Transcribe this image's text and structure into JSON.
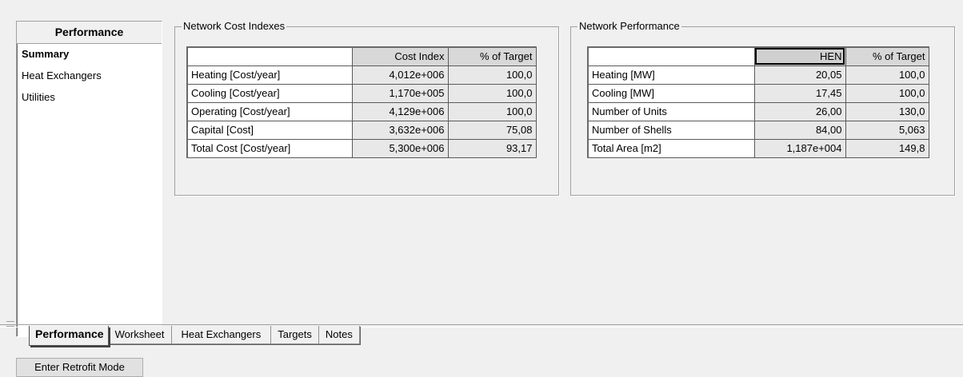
{
  "sidebar": {
    "header": "Performance",
    "items": [
      {
        "label": "Summary"
      },
      {
        "label": "Heat Exchangers"
      },
      {
        "label": "Utilities"
      }
    ]
  },
  "cost_group": {
    "title": "Network Cost Indexes",
    "columns": [
      "",
      "Cost Index",
      "% of Target"
    ],
    "rows": [
      {
        "label": "Heating [Cost/year]",
        "value": "4,012e+006",
        "target": "100,0"
      },
      {
        "label": "Cooling [Cost/year]",
        "value": "1,170e+005",
        "target": "100,0"
      },
      {
        "label": "Operating [Cost/year]",
        "value": "4,129e+006",
        "target": "100,0"
      },
      {
        "label": "Capital [Cost]",
        "value": "3,632e+006",
        "target": "75,08"
      },
      {
        "label": "Total Cost [Cost/year]",
        "value": "5,300e+006",
        "target": "93,17"
      }
    ]
  },
  "perf_group": {
    "title": "Network Performance",
    "columns": [
      "",
      "HEN",
      "% of Target"
    ],
    "rows": [
      {
        "label": "Heating [MW]",
        "value": "20,05",
        "target": "100,0"
      },
      {
        "label": "Cooling [MW]",
        "value": "17,45",
        "target": "100,0"
      },
      {
        "label": "Number of Units",
        "value": "26,00",
        "target": "130,0"
      },
      {
        "label": "Number of Shells",
        "value": "84,00",
        "target": "5,063"
      },
      {
        "label": "Total Area [m2]",
        "value": "1,187e+004",
        "target": "149,8"
      }
    ]
  },
  "tabs": [
    {
      "label": "Performance",
      "active": true
    },
    {
      "label": "Worksheet"
    },
    {
      "label": "Heat Exchangers"
    },
    {
      "label": "Targets"
    },
    {
      "label": "Notes"
    }
  ],
  "retrofit_button": "Enter Retrofit Mode"
}
